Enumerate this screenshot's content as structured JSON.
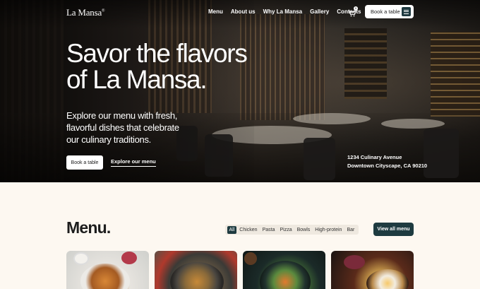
{
  "brand": {
    "name": "La Mansa",
    "mark": "®"
  },
  "nav": {
    "items": [
      "Menu",
      "About us",
      "Why La Mansa",
      "Gallery",
      "Contacts"
    ],
    "cart_count": "0",
    "book_label": "Book a table"
  },
  "hero": {
    "headline_line1": "Savor the flavors",
    "headline_line2": "of La Mansa.",
    "subtitle_line1": "Explore our menu with fresh,",
    "subtitle_line2": "flavorful dishes that celebrate",
    "subtitle_line3": "our culinary traditions.",
    "book_label": "Book a table",
    "explore_label": "Explore our menu",
    "address_line1": "1234 Culinary Avenue",
    "address_line2": "Downtown Cityscape, CA 90210"
  },
  "menu": {
    "title": "Menu.",
    "filters": [
      "All",
      "Chicken",
      "Pasta",
      "Pizza",
      "Bowls",
      "High-protein",
      "Bar"
    ],
    "active_filter": "All",
    "view_all_label": "View all menu"
  },
  "colors": {
    "accent": "#1e3b40",
    "background": "#fdf8f1",
    "filter_bg": "#efe9e0"
  }
}
